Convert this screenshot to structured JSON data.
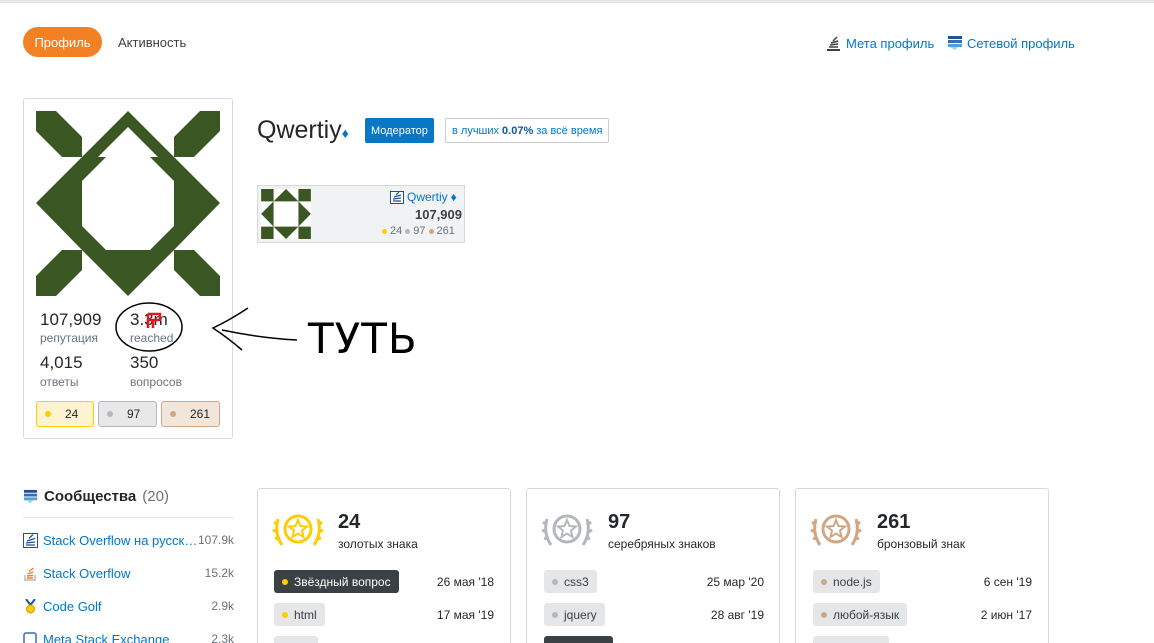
{
  "tabs": {
    "profile": "Профиль",
    "activity": "Активность"
  },
  "top_links": {
    "meta": "Мета профиль",
    "network": "Сетевой профиль"
  },
  "user": {
    "name": "Qwertiy",
    "diamond": "♦",
    "moderator": "Модератор",
    "top_prefix": "в лучших",
    "top_pct": "0.07%",
    "top_suffix": "за всё время"
  },
  "stats": {
    "reputation": "107,909",
    "reputation_label": "репутация",
    "reached": "3.3m",
    "reached_label": "reached",
    "answers": "4,015",
    "answers_label": "ответы",
    "questions": "350",
    "questions_label": "вопросов"
  },
  "badges": {
    "gold": "24",
    "silver": "97",
    "bronze": "261"
  },
  "flair": {
    "name": "Qwertiy",
    "diamond": "♦",
    "rep": "107,909",
    "gold": "24",
    "silver": "97",
    "bronze": "261"
  },
  "annotation": "ТУТЬ",
  "communities": {
    "title": "Сообщества",
    "count": "(20)",
    "items": [
      {
        "name": "Stack Overflow на русском",
        "rep": "107.9k",
        "icon": "stackoverflow-ru-icon"
      },
      {
        "name": "Stack Overflow",
        "rep": "15.2k",
        "icon": "stackoverflow-icon"
      },
      {
        "name": "Code Golf",
        "rep": "2.9k",
        "icon": "codegolf-icon"
      },
      {
        "name": "Meta Stack Exchange",
        "rep": "2.3k",
        "icon": "meta-se-icon"
      }
    ]
  },
  "badge_panels": {
    "gold": {
      "count": "24",
      "label": "золотых знака",
      "items": [
        {
          "name": "Звёздный вопрос",
          "date": "26 мая '18"
        },
        {
          "name": "html",
          "date": "17 мая '19"
        }
      ]
    },
    "silver": {
      "count": "97",
      "label": "серебряных знаков",
      "items": [
        {
          "name": "css3",
          "date": "25 мар '20"
        },
        {
          "name": "jquery",
          "date": "28 авг '19"
        }
      ]
    },
    "bronze": {
      "count": "261",
      "label": "бронзовый знак",
      "items": [
        {
          "name": "node.js",
          "date": "6 сен '19"
        },
        {
          "name": "любой-язык",
          "date": "2 июн '17"
        }
      ]
    }
  },
  "colors": {
    "accent": "#f48024",
    "link": "#0077cc",
    "avatar": "#3a5622",
    "gold": "#ffcc01",
    "silver": "#b4b8bc",
    "bronze": "#d1a684"
  }
}
